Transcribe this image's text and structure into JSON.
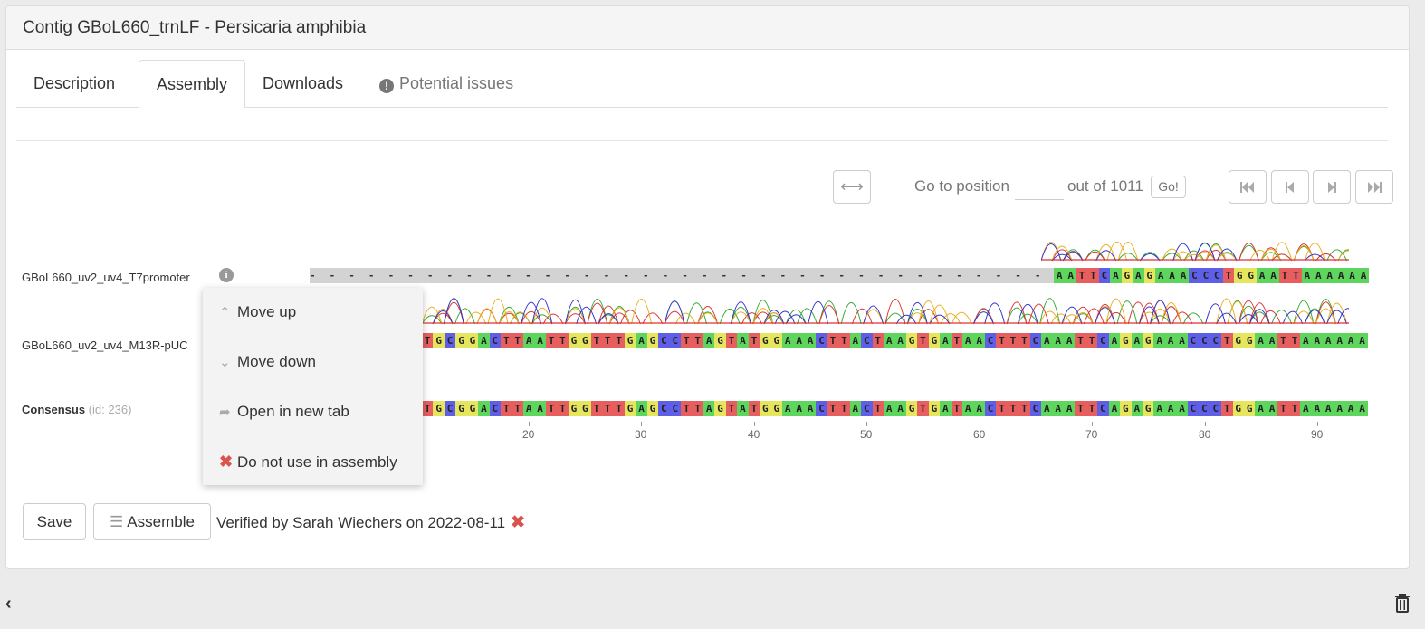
{
  "window": {
    "title": "Contig GBoL660_trnLF - Persicaria amphibia"
  },
  "tabs": [
    {
      "label": "Description"
    },
    {
      "label": "Assembly"
    },
    {
      "label": "Downloads"
    },
    {
      "label": "Potential issues",
      "icon": "exclamation-circle-icon"
    }
  ],
  "navigator": {
    "expand_icon": "horizontal-arrows-icon",
    "goto_label": "Go to position",
    "position_value": "",
    "out_of_label": "out of 1011",
    "go_label": "Go!",
    "first_icon": "skip-to-start-icon",
    "prev_icon": "step-back-icon",
    "next_icon": "step-forward-icon",
    "last_icon": "skip-to-end-icon"
  },
  "reads": [
    {
      "name": "GBoL660_uv2_uv4_T7promoter",
      "sequence": "AATTCAGAGAAACCCTGGAATTAAAAAA"
    },
    {
      "name": "GBoL660_uv2_uv4_M13R-pUC",
      "sequence": "TGCGGACTTAATTGGTTTGAGCCTTAGTATGGAAACTTACTAAGTGATAACTTTCAAATTCAGAGAAACCCTGGAATTAAAAAA"
    }
  ],
  "consensus": {
    "label": "Consensus",
    "id_label": "(id: 236)",
    "sequence": "TGCGGACTTAATTGGTTTGAGCCTTAGTATGGAAACTTACTAAGTGATAACTTTCAAATTCAGAGAAACCCTGGAATTAAAAAA"
  },
  "ruler": {
    "ticks": [
      "20",
      "30",
      "40",
      "50",
      "60",
      "70",
      "80",
      "90"
    ]
  },
  "context_menu": {
    "items": [
      {
        "label": "Move up",
        "icon": "chevron-up-icon"
      },
      {
        "label": "Move down",
        "icon": "chevron-down-icon"
      },
      {
        "label": "Open in new tab",
        "icon": "share-arrow-icon"
      },
      {
        "label": "Do not use in assembly",
        "icon": "red-x-icon"
      }
    ]
  },
  "footer": {
    "save_label": "Save",
    "assemble_label": "Assemble",
    "verified_text": "Verified by Sarah Wiechers on 2022-08-11"
  },
  "colors": {
    "A": "#5ed65e",
    "C": "#5e5ee6",
    "G": "#e6e65e",
    "T": "#e65e5e"
  }
}
